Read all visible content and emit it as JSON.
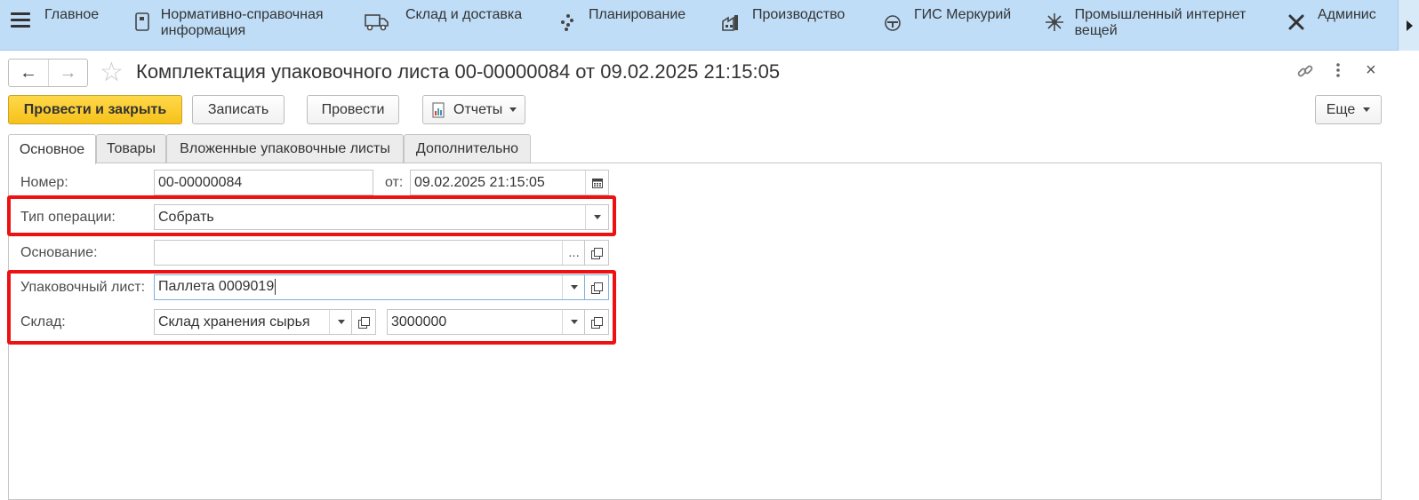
{
  "sections": [
    {
      "icon": "home-icon",
      "label": "Главное"
    },
    {
      "icon": "book-icon",
      "label": "Нормативно-справочная информация"
    },
    {
      "icon": "truck-icon",
      "label": "Склад и доставка"
    },
    {
      "icon": "planning-icon",
      "label": "Планирование"
    },
    {
      "icon": "factory-icon",
      "label": "Производство"
    },
    {
      "icon": "mercury-icon",
      "label": "ГИС Меркурий"
    },
    {
      "icon": "iot-icon",
      "label": "Промышленный интернет вещей"
    },
    {
      "icon": "tools-icon",
      "label": "Админис"
    }
  ],
  "header": {
    "title": "Комплектация упаковочного листа 00-00000084 от 09.02.2025 21:15:05",
    "back": "←",
    "forward": "→",
    "link_icon": "link-icon",
    "more_icon": "vertical-dots-icon",
    "close": "×"
  },
  "toolbar": {
    "post_close": "Провести и закрыть",
    "save": "Записать",
    "post": "Провести",
    "reports": "Отчеты",
    "more": "Еще"
  },
  "tabs": [
    "Основное",
    "Товары",
    "Вложенные упаковочные листы",
    "Дополнительно"
  ],
  "form": {
    "number_label": "Номер:",
    "number_value": "00-00000084",
    "date_label": "от:",
    "date_value": "09.02.2025 21:15:05",
    "optype_label": "Тип операции:",
    "optype_value": "Собрать",
    "basis_label": "Основание:",
    "basis_value": "",
    "basis_select": "...",
    "packlist_label": "Упаковочный лист:",
    "packlist_value": "Паллета 0009019",
    "warehouse_label": "Склад:",
    "warehouse_value": "Склад хранения сырья",
    "cell_value": "3000000"
  },
  "colors": {
    "topbar": "#bfddf7",
    "primary_button": "#f6c21a",
    "highlight": "#ee1111"
  }
}
